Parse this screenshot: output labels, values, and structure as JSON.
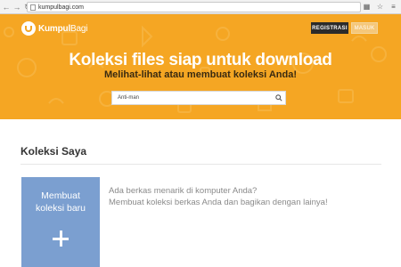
{
  "browser": {
    "url": "kumpulbagi.com",
    "back_icon": "back-arrow-icon",
    "forward_icon": "forward-arrow-icon"
  },
  "header": {
    "logo_bold": "Kumpul",
    "logo_light": "Bagi",
    "register_label": "REGISTRASI",
    "login_label": "MASUK"
  },
  "hero": {
    "title": "Koleksi files siap untuk download",
    "subtitle": "Melihat-lihat atau membuat koleksi Anda!",
    "background_color": "#f5a623"
  },
  "search": {
    "value": "Anti-man"
  },
  "collections": {
    "section_title": "Koleksi Saya",
    "create_label_line1": "Membuat",
    "create_label_line2": "koleksi baru",
    "card_color": "#7b9fd0",
    "info_line1": "Ada berkas menarik di komputer Anda?",
    "info_line2": "Membuat koleksi berkas Anda dan bagikan dengan lainya!"
  }
}
